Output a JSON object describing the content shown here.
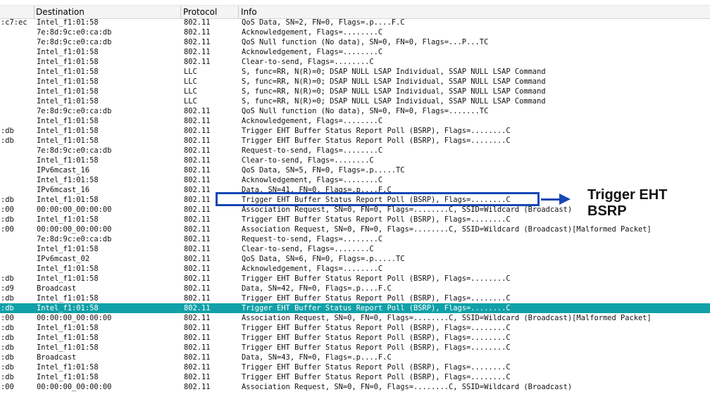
{
  "columns": {
    "destination": "Destination",
    "protocol": "Protocol",
    "info": "Info"
  },
  "packets": [
    {
      "src": ":c7:ec",
      "dst": "Intel_f1:01:58",
      "proto": "802.11",
      "info": "QoS Data, SN=2, FN=0, Flags=.p....F.C"
    },
    {
      "src": "",
      "dst": "7e:8d:9c:e0:ca:db",
      "proto": "802.11",
      "info": "Acknowledgement, Flags=........C"
    },
    {
      "src": "",
      "dst": "7e:8d:9c:e0:ca:db",
      "proto": "802.11",
      "info": "QoS Null function (No data), SN=0, FN=0, Flags=...P...TC"
    },
    {
      "src": "",
      "dst": "Intel_f1:01:58",
      "proto": "802.11",
      "info": "Acknowledgement, Flags=........C"
    },
    {
      "src": "",
      "dst": "Intel_f1:01:58",
      "proto": "802.11",
      "info": "Clear-to-send, Flags=........C"
    },
    {
      "src": "",
      "dst": "Intel_f1:01:58",
      "proto": "LLC",
      "info": "S, func=RR, N(R)=0; DSAP NULL LSAP Individual, SSAP NULL LSAP Command"
    },
    {
      "src": "",
      "dst": "Intel_f1:01:58",
      "proto": "LLC",
      "info": "S, func=RR, N(R)=0; DSAP NULL LSAP Individual, SSAP NULL LSAP Command"
    },
    {
      "src": "",
      "dst": "Intel_f1:01:58",
      "proto": "LLC",
      "info": "S, func=RR, N(R)=0; DSAP NULL LSAP Individual, SSAP NULL LSAP Command"
    },
    {
      "src": "",
      "dst": "Intel_f1:01:58",
      "proto": "LLC",
      "info": "S, func=RR, N(R)=0; DSAP NULL LSAP Individual, SSAP NULL LSAP Command"
    },
    {
      "src": "",
      "dst": "7e:8d:9c:e0:ca:db",
      "proto": "802.11",
      "info": "QoS Null function (No data), SN=0, FN=0, Flags=.......TC"
    },
    {
      "src": "",
      "dst": "Intel_f1:01:58",
      "proto": "802.11",
      "info": "Acknowledgement, Flags=........C"
    },
    {
      "src": ":db",
      "dst": "Intel_f1:01:58",
      "proto": "802.11",
      "info": "Trigger EHT Buffer Status Report Poll (BSRP), Flags=........C"
    },
    {
      "src": ":db",
      "dst": "Intel_f1:01:58",
      "proto": "802.11",
      "info": "Trigger EHT Buffer Status Report Poll (BSRP), Flags=........C"
    },
    {
      "src": "",
      "dst": "7e:8d:9c:e0:ca:db",
      "proto": "802.11",
      "info": "Request-to-send, Flags=........C"
    },
    {
      "src": "",
      "dst": "Intel_f1:01:58",
      "proto": "802.11",
      "info": "Clear-to-send, Flags=........C"
    },
    {
      "src": "",
      "dst": "IPv6mcast_16",
      "proto": "802.11",
      "info": "QoS Data, SN=5, FN=0, Flags=.p.....TC"
    },
    {
      "src": "",
      "dst": "Intel_f1:01:58",
      "proto": "802.11",
      "info": "Acknowledgement, Flags=........C"
    },
    {
      "src": "",
      "dst": "IPv6mcast_16",
      "proto": "802.11",
      "info": "Data, SN=41, FN=0, Flags=.p....F.C"
    },
    {
      "src": ":db",
      "dst": "Intel_f1:01:58",
      "proto": "802.11",
      "info": "Trigger EHT Buffer Status Report Poll (BSRP), Flags=........C"
    },
    {
      "src": ":00",
      "dst": "00:00:00_00:00:00",
      "proto": "802.11",
      "info": "Association Request, SN=0, FN=0, Flags=........C, SSID=Wildcard (Broadcast)"
    },
    {
      "src": ":db",
      "dst": "Intel_f1:01:58",
      "proto": "802.11",
      "info": "Trigger EHT Buffer Status Report Poll (BSRP), Flags=........C"
    },
    {
      "src": ":00",
      "dst": "00:00:00_00:00:00",
      "proto": "802.11",
      "info": "Association Request, SN=0, FN=0, Flags=........C, SSID=Wildcard (Broadcast)[Malformed Packet]"
    },
    {
      "src": "",
      "dst": "7e:8d:9c:e0:ca:db",
      "proto": "802.11",
      "info": "Request-to-send, Flags=........C"
    },
    {
      "src": "",
      "dst": "Intel_f1:01:58",
      "proto": "802.11",
      "info": "Clear-to-send, Flags=........C"
    },
    {
      "src": "",
      "dst": "IPv6mcast_02",
      "proto": "802.11",
      "info": "QoS Data, SN=6, FN=0, Flags=.p.....TC"
    },
    {
      "src": "",
      "dst": "Intel_f1:01:58",
      "proto": "802.11",
      "info": "Acknowledgement, Flags=........C"
    },
    {
      "src": ":db",
      "dst": "Intel_f1:01:58",
      "proto": "802.11",
      "info": "Trigger EHT Buffer Status Report Poll (BSRP), Flags=........C"
    },
    {
      "src": ":d9",
      "dst": "Broadcast",
      "proto": "802.11",
      "info": "Data, SN=42, FN=0, Flags=.p....F.C"
    },
    {
      "src": ":db",
      "dst": "Intel_f1:01:58",
      "proto": "802.11",
      "info": "Trigger EHT Buffer Status Report Poll (BSRP), Flags=........C"
    },
    {
      "src": ":db",
      "dst": "Intel_f1:01:58",
      "proto": "802.11",
      "info": "Trigger EHT Buffer Status Report Poll (BSRP), Flags=........C",
      "selected": true
    },
    {
      "src": ":00",
      "dst": "00:00:00_00:00:00",
      "proto": "802.11",
      "info": "Association Request, SN=0, FN=0, Flags=........C, SSID=Wildcard (Broadcast)[Malformed Packet]"
    },
    {
      "src": ":db",
      "dst": "Intel_f1:01:58",
      "proto": "802.11",
      "info": "Trigger EHT Buffer Status Report Poll (BSRP), Flags=........C"
    },
    {
      "src": ":db",
      "dst": "Intel_f1:01:58",
      "proto": "802.11",
      "info": "Trigger EHT Buffer Status Report Poll (BSRP), Flags=........C"
    },
    {
      "src": ":db",
      "dst": "Intel_f1:01:58",
      "proto": "802.11",
      "info": "Trigger EHT Buffer Status Report Poll (BSRP), Flags=........C"
    },
    {
      "src": ":db",
      "dst": "Broadcast",
      "proto": "802.11",
      "info": "Data, SN=43, FN=0, Flags=.p....F.C"
    },
    {
      "src": ":db",
      "dst": "Intel_f1:01:58",
      "proto": "802.11",
      "info": "Trigger EHT Buffer Status Report Poll (BSRP), Flags=........C"
    },
    {
      "src": ":db",
      "dst": "Intel_f1:01:58",
      "proto": "802.11",
      "info": "Trigger EHT Buffer Status Report Poll (BSRP), Flags=........C"
    },
    {
      "src": ":00",
      "dst": "00:00:00_00:00:00",
      "proto": "802.11",
      "info": "Association Request, SN=0, FN=0, Flags=........C, SSID=Wildcard (Broadcast)"
    }
  ],
  "annotation": {
    "label": "Trigger EHT BSRP",
    "color": "#1747b6"
  },
  "colors": {
    "selected_row": "#12a0a8"
  }
}
